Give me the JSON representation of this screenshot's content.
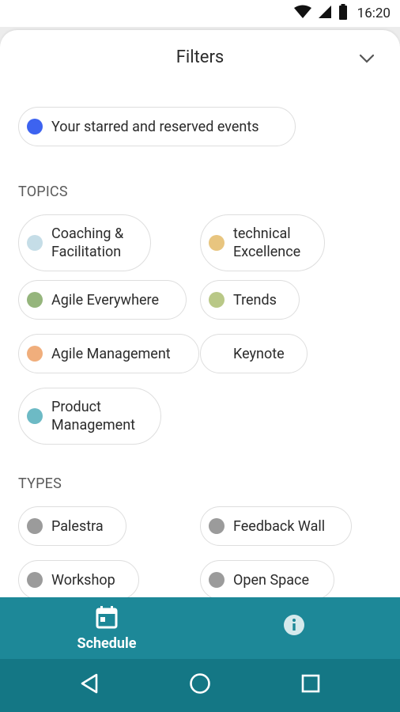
{
  "status_bar": {
    "time": "16:20"
  },
  "sheet": {
    "title": "Filters"
  },
  "starred_chip": {
    "label": "Your starred and reserved events",
    "color": "#3d63f0"
  },
  "topics": {
    "heading": "TOPICS",
    "items": [
      {
        "label": "Coaching &\nFacilitation",
        "color": "#c5dde7"
      },
      {
        "label": "technical\nExcellence",
        "color": "#e8c57f"
      },
      {
        "label": "Agile Everywhere",
        "color": "#95b57c"
      },
      {
        "label": "Trends",
        "color": "#b9c887"
      },
      {
        "label": "Agile Management",
        "color": "#f0ae7c"
      },
      {
        "label": "Keynote",
        "color": "transparent"
      },
      {
        "label": "Product\nManagement",
        "color": "#6dbac5"
      }
    ]
  },
  "types": {
    "heading": "TYPES",
    "items": [
      {
        "label": "Palestra",
        "color": "#9b9b9b"
      },
      {
        "label": "Feedback Wall",
        "color": "#9b9b9b"
      },
      {
        "label": "Workshop",
        "color": "#9b9b9b"
      },
      {
        "label": "Open Space",
        "color": "#9b9b9b"
      }
    ]
  },
  "bottom_nav": {
    "schedule_label": "Schedule",
    "active_color": "#ffffff",
    "bar_color": "#1d8898"
  }
}
